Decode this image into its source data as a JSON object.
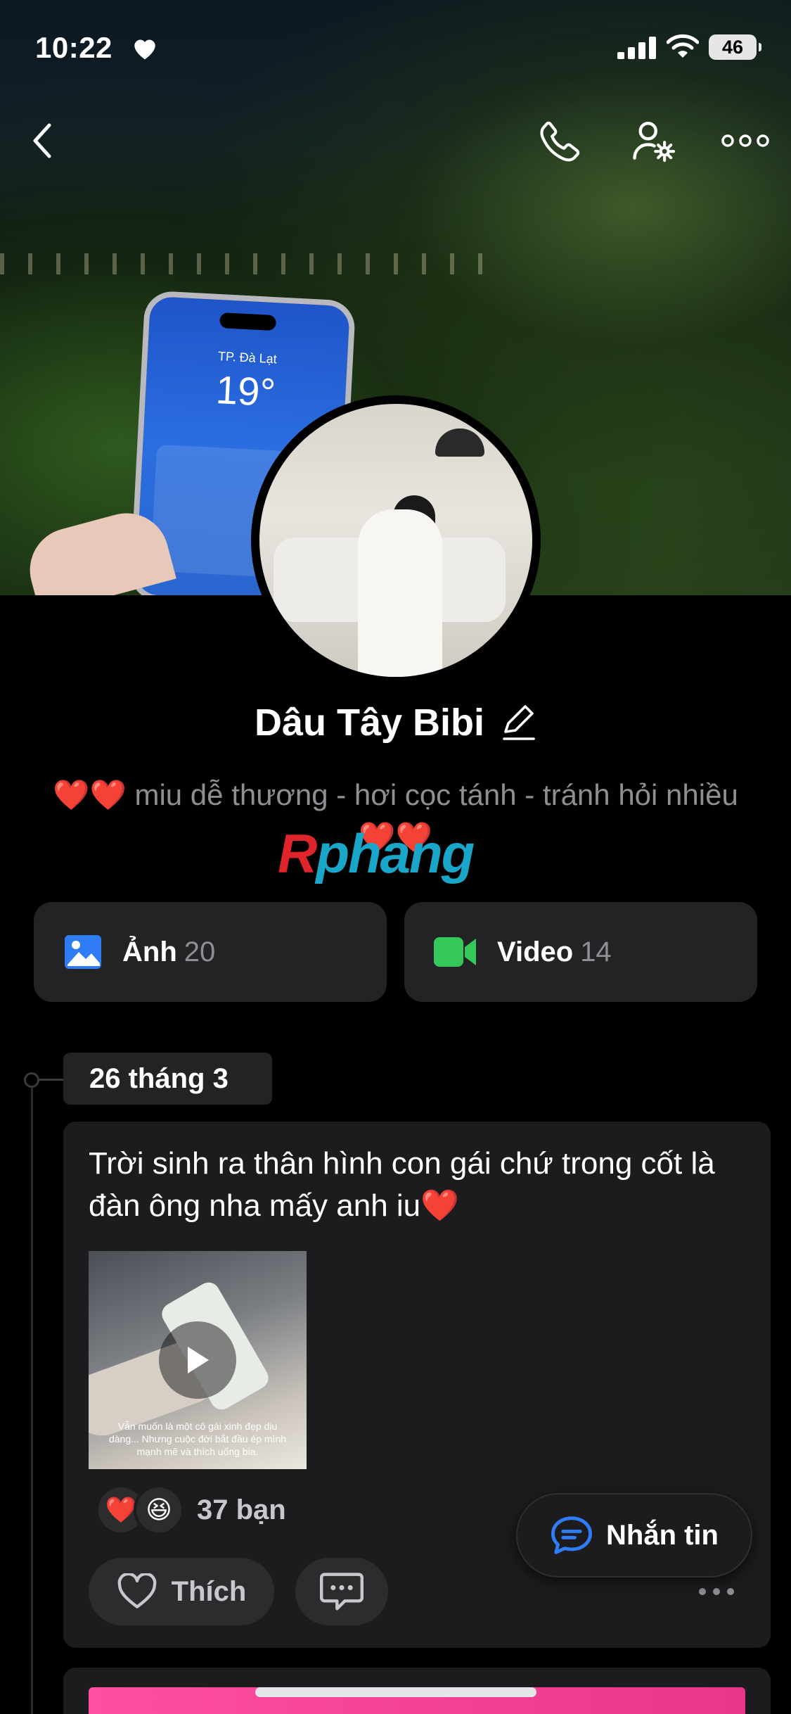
{
  "status_bar": {
    "time": "10:22",
    "battery": "46"
  },
  "nav": {
    "back_icon": "chevron-left-icon",
    "call_icon": "phone-icon",
    "profile_settings_icon": "user-gear-icon",
    "more_icon": "ellipsis-icon"
  },
  "cover": {
    "phone_city": "TP. Đà Lạt",
    "phone_temp": "19°"
  },
  "profile": {
    "name": "Dâu Tây Bibi",
    "bio": "❤️❤️ miu dễ thương - hơi cọc tánh - tránh hỏi nhiều ❤️❤️",
    "watermark_first": "R",
    "watermark_rest": "phang"
  },
  "media": {
    "photos_label": "Ảnh",
    "photos_count": "20",
    "videos_label": "Video",
    "videos_count": "14",
    "photos_color": "#2f7cf6",
    "videos_color": "#34c759"
  },
  "timeline": {
    "date": "26 tháng 3",
    "post": {
      "text": "Trời sinh ra thân hình con gái chứ trong cốt là đàn ông nha mấy anh iu❤️",
      "thumb_caption": "Vẫn muốn là một cô gái xinh đẹp dịu dàng... Nhưng cuộc đời bắt đầu ép mình mạnh mẽ và thích uống bia.",
      "reactions": [
        "❤️",
        "😆"
      ],
      "reaction_count": "37 bạn",
      "like_label": "Thích"
    }
  },
  "message_button": {
    "label": "Nhắn tin",
    "accent": "#2f7cf6"
  }
}
